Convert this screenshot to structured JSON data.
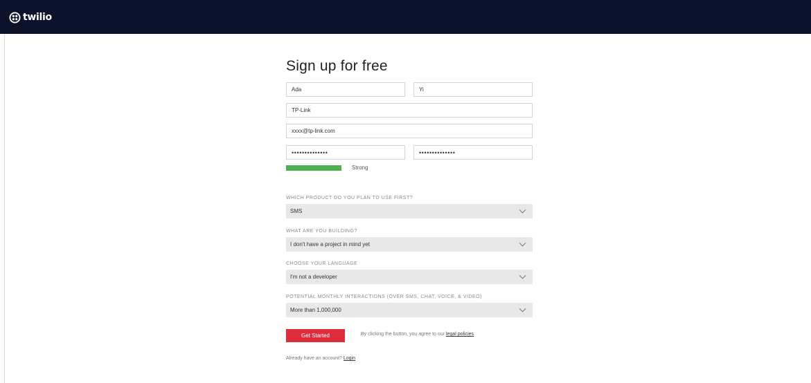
{
  "brand": {
    "name": "twilio",
    "bar_color": "#0d122b",
    "accent": "#e02d3c",
    "strength_color": "#4caf50"
  },
  "form": {
    "title": "Sign up for free",
    "first_name": "Ada",
    "last_name": "Yi",
    "company": "TP-Link",
    "email": "xxxx@tp-link.com",
    "password": "••••••••••••••",
    "password_confirm": "••••••••••••••",
    "strength_label": "Strong",
    "strength_level": 1.0
  },
  "questions": [
    {
      "label": "WHICH PRODUCT DO YOU PLAN TO USE FIRST?",
      "value": "SMS"
    },
    {
      "label": "WHAT ARE YOU BUILDING?",
      "value": "I don't have a project in mind yet"
    },
    {
      "label": "CHOOSE YOUR LANGUAGE",
      "value": "I'm not a developer"
    },
    {
      "label": "POTENTIAL MONTHLY INTERACTIONS (OVER SMS, CHAT, VOICE, & VIDEO)",
      "value": "More than 1,000,000"
    }
  ],
  "cta": {
    "button_label": "Get Started",
    "agree_text": "By clicking the button, you agree to our ",
    "agree_link": "legal policies"
  },
  "login": {
    "prompt": "Already have an account? ",
    "link": "Login"
  },
  "icons": {
    "logo": "twilio-logo-icon",
    "dropdown": "chevron-down-icon"
  }
}
